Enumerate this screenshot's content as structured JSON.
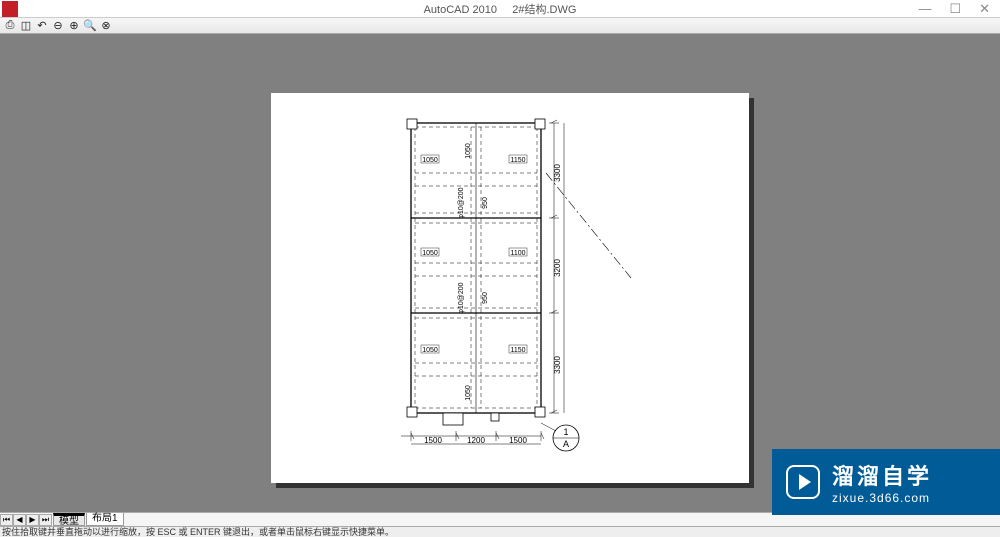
{
  "title": {
    "app": "AutoCAD 2010",
    "file": "2#结构.DWG"
  },
  "windowControls": {
    "min": "—",
    "max": "☐",
    "close": "✕"
  },
  "toolbar": {
    "print": "⎙",
    "page1": "◫",
    "back": "↶",
    "zoomOut": "⊖",
    "zoomIn": "⊕",
    "magnify": "🔍",
    "closePreview": "⊗"
  },
  "drawing": {
    "dimRight": [
      "3300",
      "3200",
      "3300"
    ],
    "dimBottom": [
      "1500",
      "1200",
      "1500"
    ],
    "innerLeft": [
      "1050",
      "1050",
      "1050"
    ],
    "innerRight": [
      "1150",
      "1100",
      "1150"
    ],
    "vert": {
      "a": "1050",
      "b": "950",
      "c": "950",
      "d": "1050"
    },
    "rebarText": "φ10@200",
    "rebarText2": "φ10@200",
    "gridMarks": {
      "num": "1",
      "let": "A"
    }
  },
  "tabs": {
    "model": "模型",
    "layout1": "布局1"
  },
  "status": "按住拾取键并垂直拖动以进行缩放，按 ESC 或 ENTER 键退出，或者单击鼠标右键显示快捷菜单。",
  "watermark": {
    "title": "溜溜自学",
    "sub": "zixue.3d66.com"
  }
}
